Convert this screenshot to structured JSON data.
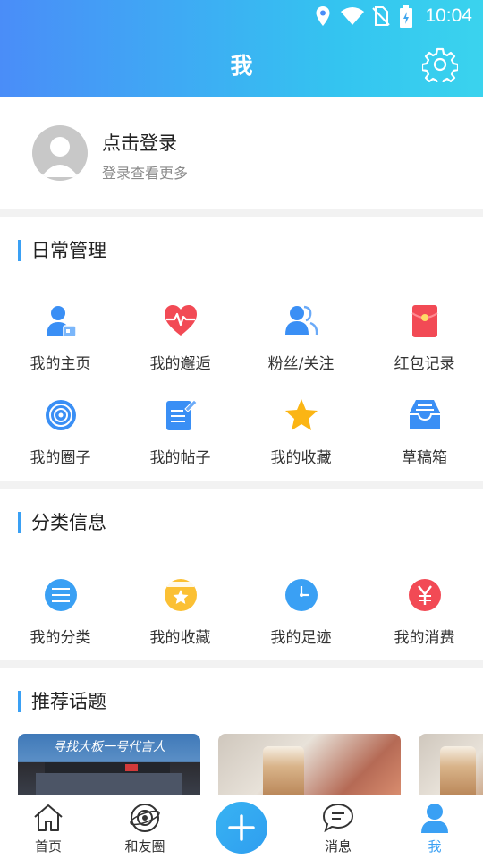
{
  "status_bar": {
    "time": "10:04"
  },
  "header": {
    "title": "我",
    "settings_icon": "gear-icon"
  },
  "profile": {
    "name": "点击登录",
    "subtitle": "登录查看更多",
    "avatar_icon": "default-avatar-icon"
  },
  "daily": {
    "title": "日常管理",
    "items": [
      {
        "label": "我的主页",
        "icon": "user-card-icon",
        "color": "#3a8ff5"
      },
      {
        "label": "我的邂逅",
        "icon": "heartbeat-icon",
        "color": "#f24a55"
      },
      {
        "label": "粉丝/关注",
        "icon": "users-icon",
        "color": "#3a8ff5"
      },
      {
        "label": "红包记录",
        "icon": "red-envelope-icon",
        "color": "#f24a55"
      },
      {
        "label": "我的圈子",
        "icon": "circle-target-icon",
        "color": "#3a8ff5"
      },
      {
        "label": "我的帖子",
        "icon": "post-edit-icon",
        "color": "#3a8ff5"
      },
      {
        "label": "我的收藏",
        "icon": "star-icon",
        "color": "#fbb514"
      },
      {
        "label": "草稿箱",
        "icon": "drafts-tray-icon",
        "color": "#3a8ff5"
      }
    ]
  },
  "category": {
    "title": "分类信息",
    "items": [
      {
        "label": "我的分类",
        "icon": "list-icon",
        "color": "#3aa0f4"
      },
      {
        "label": "我的收藏",
        "icon": "star-jar-icon",
        "color": "#fbc034"
      },
      {
        "label": "我的足迹",
        "icon": "clock-icon",
        "color": "#3aa0f4"
      },
      {
        "label": "我的消费",
        "icon": "yen-icon",
        "color": "#f24a55"
      }
    ]
  },
  "topics": {
    "title": "推荐话题",
    "thumb1_caption": "寻找大板一号代言人"
  },
  "tabbar": {
    "items": [
      {
        "label": "首页",
        "icon": "home-icon"
      },
      {
        "label": "和友圈",
        "icon": "planet-icon"
      },
      {
        "label": "",
        "icon": "plus-icon"
      },
      {
        "label": "消息",
        "icon": "chat-icon"
      },
      {
        "label": "我",
        "icon": "person-icon"
      }
    ],
    "active": "我",
    "accent": "#3aa0f4"
  }
}
